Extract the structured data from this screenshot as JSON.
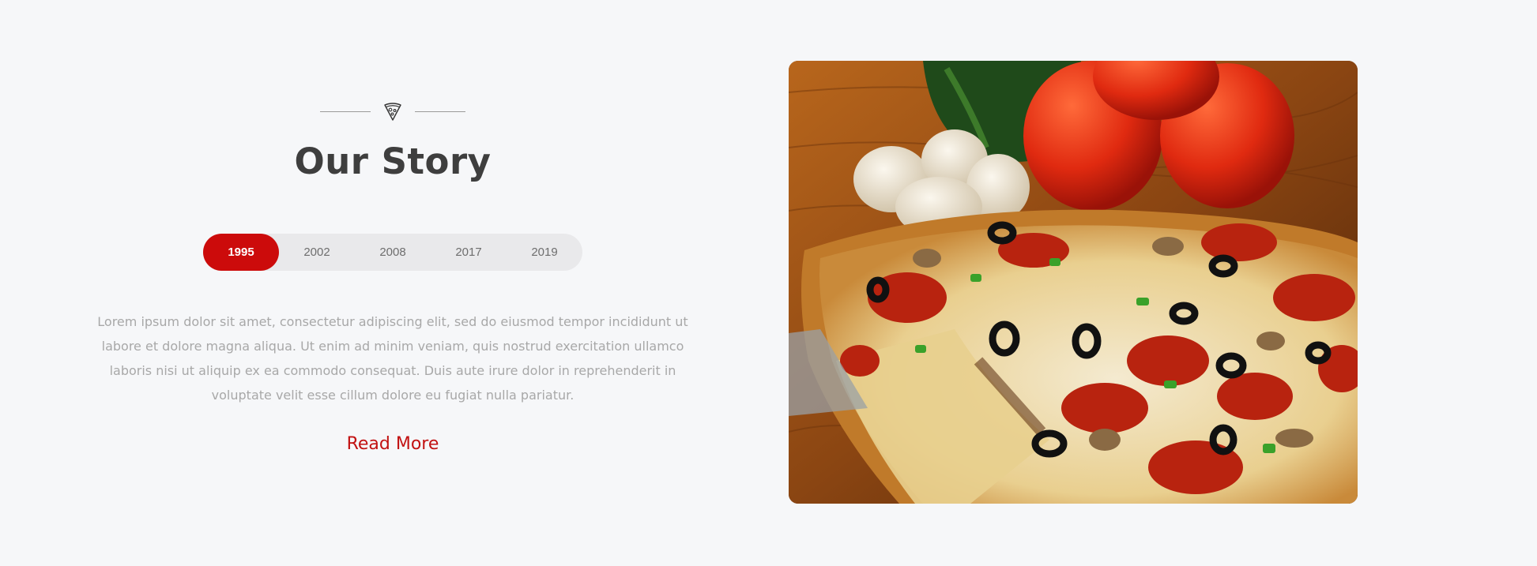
{
  "section": {
    "icon": "pizza-slice-icon",
    "title": "Our Story",
    "accent_color": "#cc0b0b"
  },
  "years": {
    "active": "1995",
    "items": [
      "1995",
      "2002",
      "2008",
      "2017",
      "2019"
    ]
  },
  "story": {
    "paragraph": "Lorem ipsum dolor sit amet, consectetur adipiscing elit, sed do eiusmod tempor incididunt ut labore et dolore magna aliqua. Ut enim ad minim veniam, quis nostrud exercitation ullamco laboris nisi ut aliquip ex ea commodo consequat. Duis aute irure dolor in reprehenderit in voluptate velit esse cillum dolore eu fugiat nulla pariatur.",
    "read_more": "Read More"
  },
  "image": {
    "subject": "pizza-photo"
  }
}
